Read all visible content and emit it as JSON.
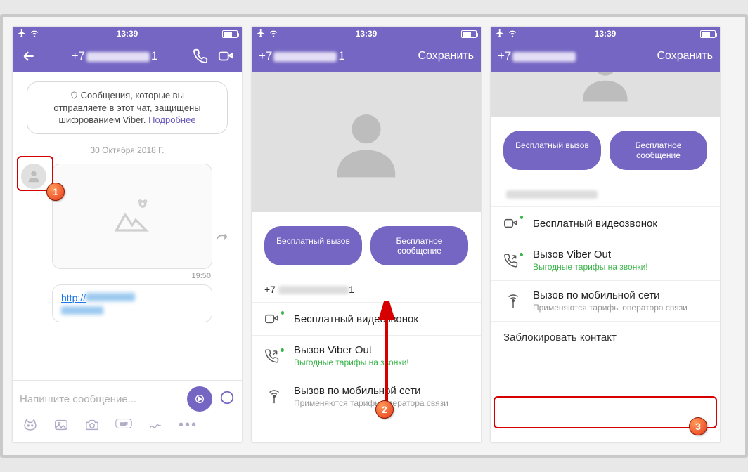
{
  "status": {
    "time": "13:39"
  },
  "screen1": {
    "title_prefix": "+7",
    "title_suffix": "1",
    "banner_line1": "Сообщения, которые вы",
    "banner_line2": "отправляете в этот чат, защищены",
    "banner_line3_a": "шифрованием Viber. ",
    "banner_more": "Подробнее",
    "date": "30 Октября 2018 Г.",
    "msg_time": "19:50",
    "link_text": "http://",
    "composer_placeholder": "Напишите сообщение..."
  },
  "screen2": {
    "title_prefix": "+7",
    "title_suffix": "1",
    "save": "Сохранить",
    "pill_call": "Бесплатный вызов",
    "pill_msg": "Бесплатное сообщение",
    "phone_prefix": "+7",
    "phone_suffix": "1",
    "row_video": "Бесплатный видеозвонок",
    "row_viberout": "Вызов Viber Out",
    "row_viberout_sub": "Выгодные тарифы на звонки!",
    "row_cellular": "Вызов по мобильной сети",
    "row_cellular_sub": "Применяются тарифы оператора связи"
  },
  "screen3": {
    "title_prefix": "+7",
    "save": "Сохранить",
    "pill_call": "Бесплатный вызов",
    "pill_msg": "Бесплатное сообщение",
    "row_video": "Бесплатный видеозвонок",
    "row_viberout": "Вызов Viber Out",
    "row_viberout_sub": "Выгодные тарифы на звонки!",
    "row_cellular": "Вызов по мобильной сети",
    "row_cellular_sub": "Применяются тарифы оператора связи",
    "row_block": "Заблокировать контакт"
  },
  "badges": {
    "b1": "1",
    "b2": "2",
    "b3": "3"
  }
}
